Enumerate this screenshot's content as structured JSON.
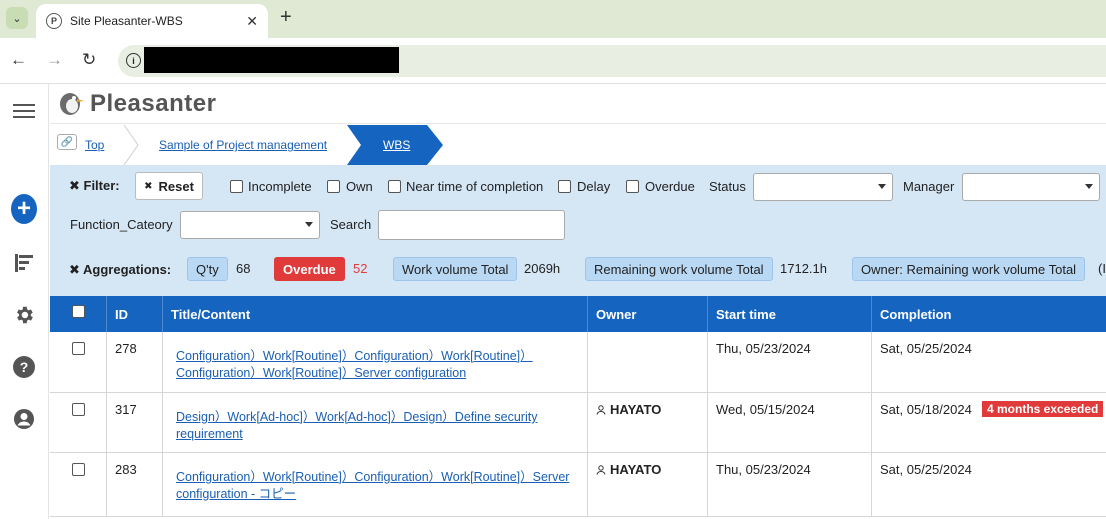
{
  "browser": {
    "tab_title": "Site Pleasanter-WBS",
    "tab_favicon": "P",
    "new_tab": "+",
    "tab_close": "✕"
  },
  "app": {
    "logo_text": "Pleasanter"
  },
  "breadcrumb": {
    "items": [
      "Top",
      "Sample of Project management",
      "WBS"
    ]
  },
  "filters": {
    "filter_label": "✖ Filter:",
    "reset_label": "Reset",
    "checkboxes": [
      "Incomplete",
      "Own",
      "Near time of completion",
      "Delay",
      "Overdue"
    ],
    "status_label": "Status",
    "manager_label": "Manager",
    "function_category_label": "Function_Cateory",
    "search_label": "Search",
    "search_value": ""
  },
  "aggregations": {
    "label": "✖ Aggregations:",
    "qty_label": "Q'ty",
    "qty_value": "68",
    "overdue_label": "Overdue",
    "overdue_value": "52",
    "work_volume_label": "Work volume Total",
    "work_volume_value": "2069h",
    "remaining_label": "Remaining work volume Total",
    "remaining_value": "1712.1h",
    "owner_remaining_label": "Owner: Remaining work volume Total",
    "owner_remaining_value": "(I"
  },
  "grid": {
    "columns": [
      "ID",
      "Title/Content",
      "Owner",
      "Start time",
      "Completion"
    ],
    "rows": [
      {
        "id": "278",
        "title": "Configuration）Work[Routine]）Configuration）Work[Routine]）Configuration）Work[Routine]）Server configuration",
        "owner": "",
        "start": "Thu, 05/23/2024",
        "completion": "Sat, 05/25/2024",
        "badge": ""
      },
      {
        "id": "317",
        "title": "Design）Work[Ad-hoc]）Work[Ad-hoc]）Design）Define security requirement",
        "owner": "HAYATO",
        "start": "Wed, 05/15/2024",
        "completion": "Sat, 05/18/2024",
        "badge": "4 months exceeded"
      },
      {
        "id": "283",
        "title": "Configuration）Work[Routine]）Configuration）Work[Routine]）Server configuration - コピー",
        "owner": "HAYATO",
        "start": "Thu, 05/23/2024",
        "completion": "Sat, 05/25/2024",
        "badge": ""
      }
    ]
  },
  "colors": {
    "primary": "#1565c0",
    "filter_bg": "#d5e6f5",
    "danger": "#e03a3a"
  }
}
